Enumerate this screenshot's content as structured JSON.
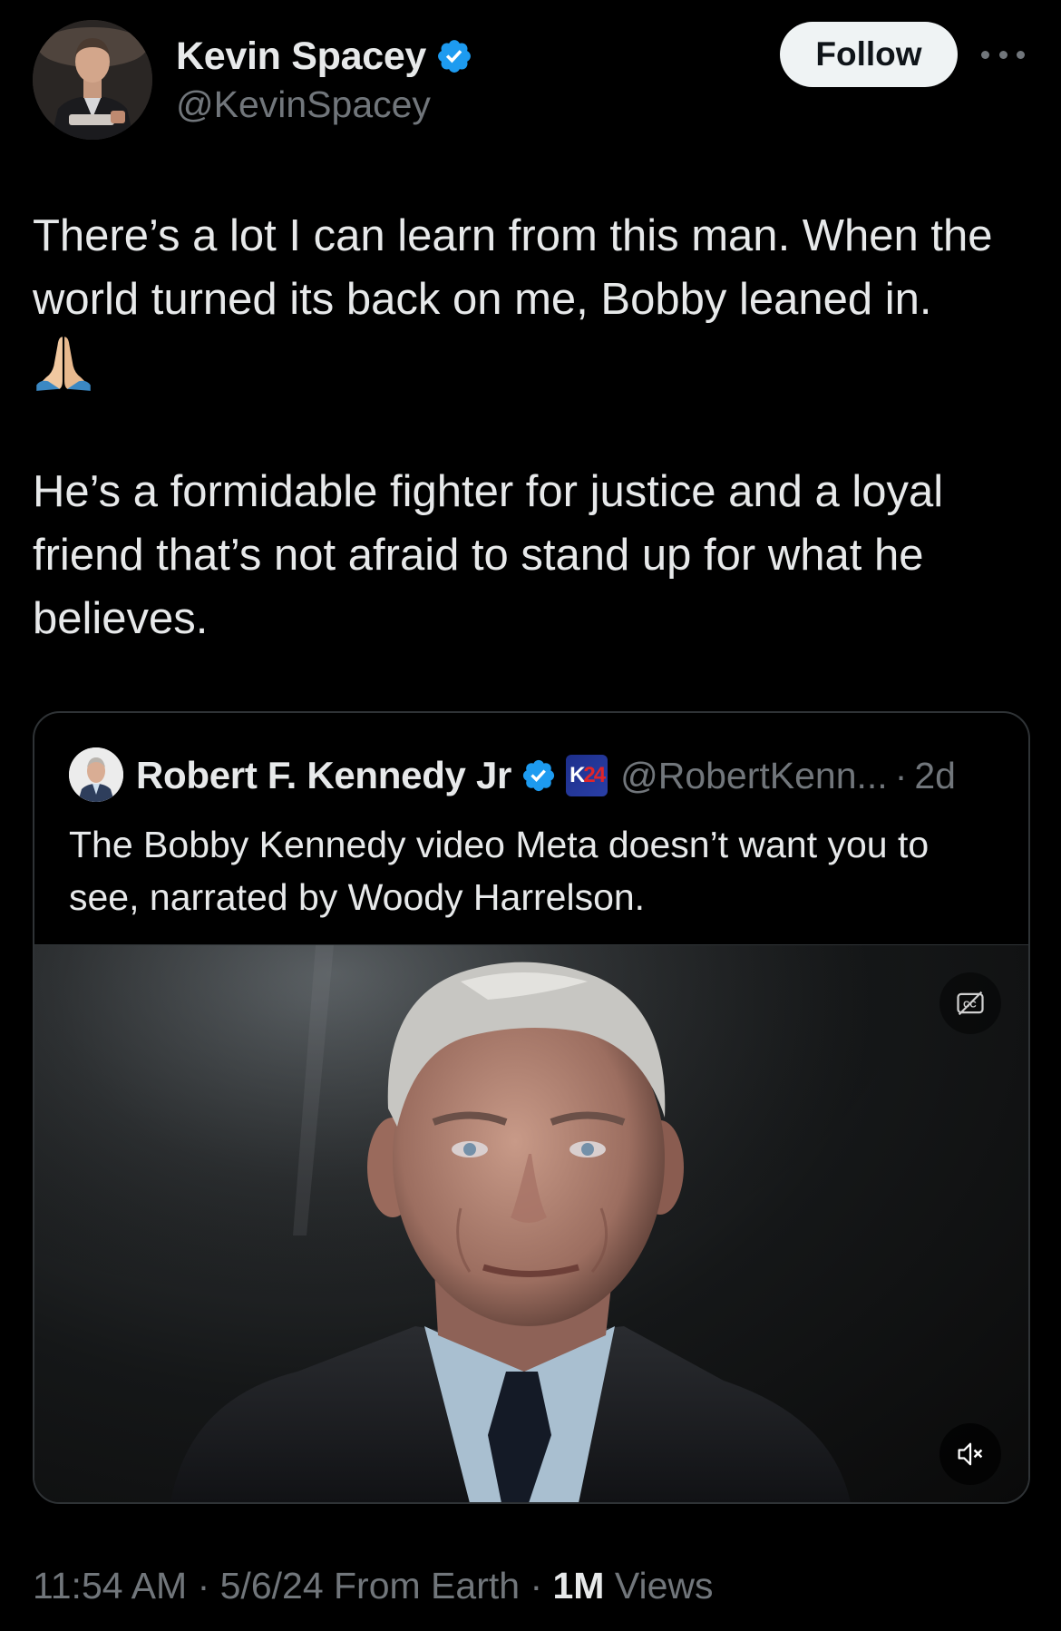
{
  "author": {
    "display_name": "Kevin Spacey",
    "handle": "@KevinSpacey",
    "verified": true
  },
  "header": {
    "follow_label": "Follow",
    "more_icon": "more-horizontal-icon"
  },
  "tweet": {
    "paragraph1": "There’s a lot I can learn from this man. When the world turned its back on me, Bobby leaned in.",
    "emoji": "folded-hands-icon",
    "paragraph2": "He’s a formidable fighter for justice and a loyal friend that’s not afraid to stand up for what he believes."
  },
  "quote": {
    "display_name": "Robert F. Kennedy Jr",
    "verified": true,
    "badge_text_blue": "K",
    "badge_text_red": "24",
    "handle": "@RobertKenn...",
    "separator": "·",
    "age": "2d",
    "text": "The Bobby Kennedy video Meta doesn’t want you to see, narrated by Woody Harrelson.",
    "video": {
      "cc_icon": "closed-captions-off-icon",
      "mute_icon": "muted-speaker-icon"
    }
  },
  "meta": {
    "time": "11:54 AM",
    "sep1": " · ",
    "date": "5/6/24",
    "source": " From Earth",
    "sep2": " · ",
    "views_count": "1M",
    "views_label": " Views"
  },
  "colors": {
    "background": "#000000",
    "text": "#e7e9ea",
    "muted": "#71767b",
    "verified_blue": "#1d9bf0",
    "border": "#2f3336"
  }
}
